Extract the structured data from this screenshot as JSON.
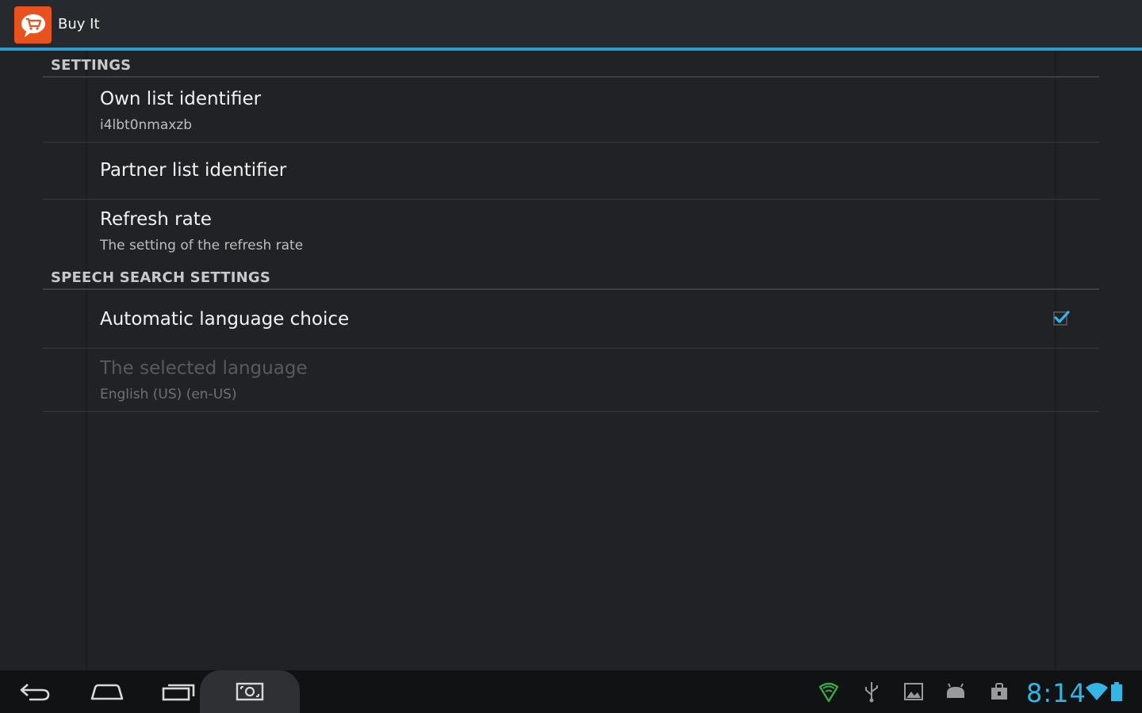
{
  "app": {
    "title": "Buy It",
    "icon": "shopping-cart-speech-bubble-icon",
    "accent_color": "#2f9bd0",
    "icon_color": "#e8521f"
  },
  "categories": [
    {
      "label": "SETTINGS",
      "items": [
        {
          "title": "Own list identifier",
          "summary": "i4lbt0nmaxzb"
        },
        {
          "title": "Partner list identifier",
          "summary": ""
        },
        {
          "title": "Refresh rate",
          "summary": "The setting of the refresh rate"
        }
      ]
    },
    {
      "label": "SPEECH SEARCH SETTINGS",
      "items": [
        {
          "title": "Automatic language choice",
          "summary": "",
          "checked": true
        },
        {
          "title": "The selected language",
          "summary": "English (US) (en-US)",
          "enabled": false
        }
      ]
    }
  ],
  "nav": {
    "buttons": [
      "back-icon",
      "home-icon",
      "recent-apps-icon",
      "screenshot-icon"
    ]
  },
  "status": {
    "icons": [
      "shield-icon",
      "usb-icon",
      "gallery-icon",
      "android-debug-icon",
      "store-bag-icon"
    ],
    "time": "8:14",
    "wifi": "wifi-icon",
    "battery": "battery-icon",
    "clock_color": "#33b5e5"
  }
}
